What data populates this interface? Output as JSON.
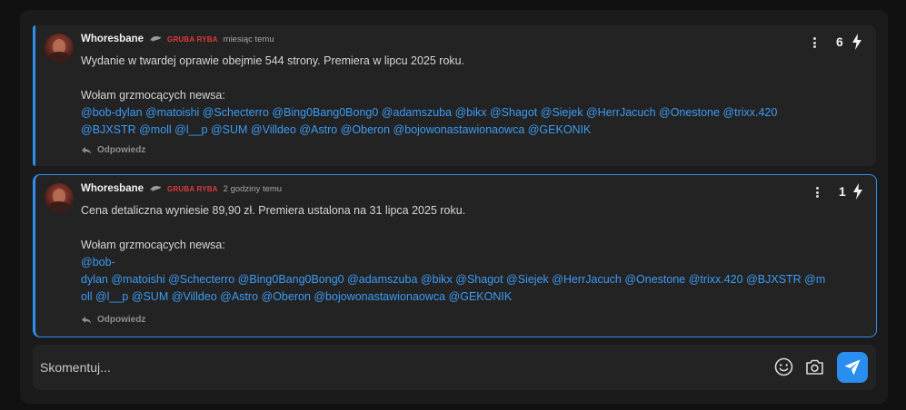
{
  "comments": [
    {
      "author": "Whoresbane",
      "rank": "GRUBA RYBA",
      "time": "miesiąc temu",
      "text": "Wydanie w twardej oprawie obejmie 544 strony. Premiera w lipcu 2025 roku.",
      "call_text": "Wołam grzmocących newsa:",
      "mentions_lines": [
        "@bob-dylan @matoishi @Schecterro @Bing0Bang0Bong0 @adamszuba @bikx @Shagot @Siejek @HerrJacuch @Onestone @trixx.420",
        "@BJXSTR @moll @l__p @SUM @Villdeo @Astro @Oberon @bojowonastawionaowca @GEKONIK"
      ],
      "votes": "6",
      "reply_label": "Odpowiedz"
    },
    {
      "author": "Whoresbane",
      "rank": "GRUBA RYBA",
      "time": "2 godziny temu",
      "text": "Cena detaliczna wyniesie 89,90 zł. Premiera ustalona na 31 lipca 2025 roku.",
      "call_text": "Wołam grzmocących newsa:",
      "mentions_lines": [
        "@bob-",
        "dylan @matoishi @Schecterro @Bing0Bang0Bong0 @adamszuba @bikx @Shagot @Siejek @HerrJacuch @Onestone @trixx.420 @BJXSTR @m",
        "oll @l__p @SUM @Villdeo @Astro @Oberon @bojowonastawionaowca @GEKONIK"
      ],
      "votes": "1",
      "reply_label": "Odpowiedz"
    }
  ],
  "composer": {
    "placeholder": "Skomentuj..."
  },
  "icons": {
    "rank": "dolphin-icon",
    "menu": "kebab-menu-icon",
    "vote": "lightning-bolt-icon",
    "reply": "reply-arrow-icon",
    "emoji": "smiley-icon",
    "camera": "camera-icon",
    "send": "paper-plane-icon"
  },
  "colors": {
    "accent": "#2e8ff0",
    "mention": "#3b9bf5",
    "rank": "#e23a3a",
    "send_button": "#2a8ef0"
  }
}
